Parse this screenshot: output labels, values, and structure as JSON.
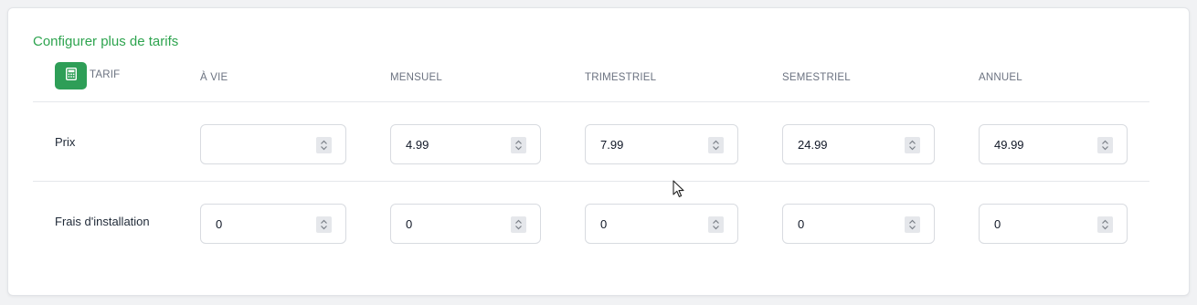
{
  "section_title": "Configurer plus de tarifs",
  "icons": {
    "tarif": "calculator-icon",
    "spinner": "spinner-arrows-icon",
    "cursor": "mouse-pointer-icon"
  },
  "colors": {
    "accent": "#2ea44f",
    "button_bg": "#2e9e57"
  },
  "headers": {
    "tarif": "TARIF",
    "a_vie": "À VIE",
    "mensuel": "MENSUEL",
    "trimestriel": "TRIMESTRIEL",
    "semestriel": "SEMESTRIEL",
    "annuel": "ANNUEL"
  },
  "rows": {
    "prix": {
      "label": "Prix",
      "a_vie": "",
      "mensuel": "4.99",
      "trimestriel": "7.99",
      "semestriel": "24.99",
      "annuel": "49.99"
    },
    "frais": {
      "label": "Frais d'installation",
      "a_vie": "0",
      "mensuel": "0",
      "trimestriel": "0",
      "semestriel": "0",
      "annuel": "0"
    }
  }
}
